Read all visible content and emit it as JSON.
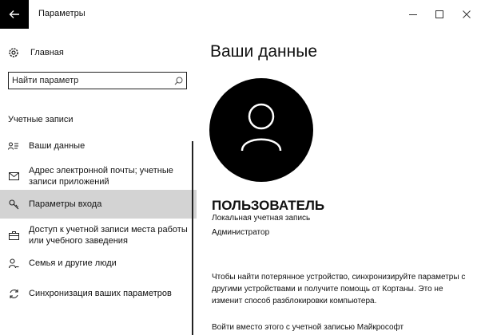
{
  "window": {
    "title": "Параметры"
  },
  "sidebar": {
    "home_label": "Главная",
    "search_placeholder": "Найти параметр",
    "section_label": "Учетные записи",
    "items": [
      {
        "label": "Ваши данные",
        "icon": "person-card-icon"
      },
      {
        "label": "Адрес электронной почты; учетные записи приложений",
        "icon": "mail-icon"
      },
      {
        "label": "Параметры входа",
        "icon": "key-icon",
        "active": true
      },
      {
        "label": "Доступ к учетной записи места работы или учебного заведения",
        "icon": "briefcase-icon"
      },
      {
        "label": "Семья и другие люди",
        "icon": "person-add-icon"
      },
      {
        "label": "Синхронизация ваших параметров",
        "icon": "sync-icon"
      }
    ]
  },
  "main": {
    "title": "Ваши данные",
    "user_name": "ПОЛЬЗОВАТЕЛЬ",
    "account_type": "Локальная учетная запись",
    "role": "Администратор",
    "description": "Чтобы найти потерянное устройство, синхронизируйте параметры с другими устройствами и получите помощь от Кортаны. Это не изменит способ разблокировки компьютера.",
    "ms_signin_link": "Войти вместо этого с учетной записью Майкрософт"
  }
}
